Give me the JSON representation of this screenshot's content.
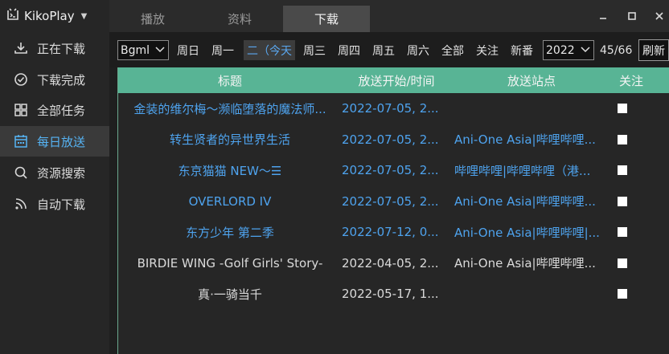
{
  "app": {
    "name": "KikoPlay"
  },
  "sidebar": {
    "items": [
      {
        "label": "正在下载",
        "icon": "download-icon"
      },
      {
        "label": "下载完成",
        "icon": "check-circle-icon"
      },
      {
        "label": "全部任务",
        "icon": "grid-icon"
      },
      {
        "label": "每日放送",
        "icon": "calendar-icon",
        "active": true
      },
      {
        "label": "资源搜索",
        "icon": "search-icon"
      },
      {
        "label": "自动下载",
        "icon": "rss-icon"
      }
    ]
  },
  "tabs": [
    {
      "label": "播放"
    },
    {
      "label": "资料"
    },
    {
      "label": "下载",
      "active": true
    }
  ],
  "toolbar": {
    "source_select": "Bgml",
    "days": [
      "周日",
      "周一",
      "二（今天",
      "周三",
      "周四",
      "周五",
      "周六",
      "全部",
      "关注",
      "新番"
    ],
    "active_day_index": 2,
    "year_select": "2022",
    "count": "45/66",
    "refresh_label": "刷新"
  },
  "table": {
    "headers": [
      "标题",
      "放送开始/时间",
      "放送站点",
      "关注"
    ],
    "rows": [
      {
        "title": "金装的维尔梅～濒临堕落的魔法师...",
        "time": "2022-07-05, 2...",
        "site": "",
        "highlight": true
      },
      {
        "title": "转生贤者的异世界生活",
        "time": "2022-07-05, 2...",
        "site": "Ani-One Asia|哔哩哔哩...",
        "highlight": true
      },
      {
        "title": "东京猫猫 NEW～☰",
        "time": "2022-07-05, 2...",
        "site": "哔哩哔哩|哔哩哔哩（港...",
        "highlight": true
      },
      {
        "title": "OVERLORD IV",
        "time": "2022-07-05, 2...",
        "site": "Ani-One Asia|哔哩哔哩...",
        "highlight": true
      },
      {
        "title": "东方少年 第二季",
        "time": "2022-07-12, 0...",
        "site": "Ani-One Asia|哔哩哔哩|...",
        "highlight": true
      },
      {
        "title": "BIRDIE WING -Golf Girls' Story-",
        "time": "2022-04-05, 2...",
        "site": "Ani-One Asia|哔哩哔哩...",
        "highlight": false
      },
      {
        "title": "真·一骑当千",
        "time": "2022-05-17, 1...",
        "site": "",
        "highlight": false
      }
    ]
  },
  "colors": {
    "accent_green": "#58b495",
    "link_blue": "#4ea3ee",
    "active_nav_blue": "#56b4f5"
  }
}
